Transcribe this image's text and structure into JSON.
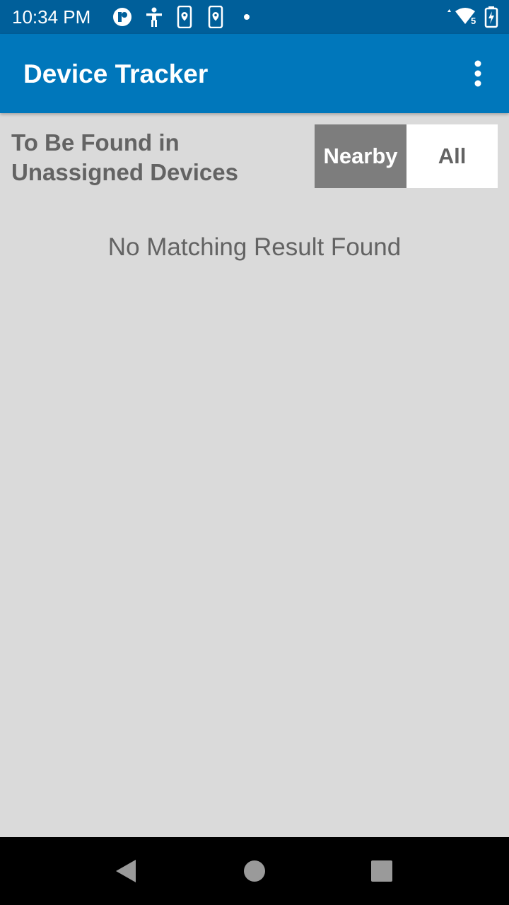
{
  "status_bar": {
    "time": "10:34 PM",
    "icons": [
      "app-notification-icon",
      "accessibility-icon",
      "device-location-icon",
      "device-location-icon",
      "dot-icon",
      "wifi-icon",
      "battery-charging-icon"
    ],
    "wifi_badge": "5"
  },
  "app_bar": {
    "title": "Device Tracker",
    "menu_icon": "more-vert-icon"
  },
  "header": {
    "title": "To Be Found in Unassigned Devices",
    "toggle": {
      "options": [
        "Nearby",
        "All"
      ],
      "selected": "Nearby"
    }
  },
  "results": {
    "empty_message": "No Matching Result Found"
  },
  "nav_bar": {
    "icons": [
      "back-icon",
      "home-icon",
      "recents-icon"
    ]
  },
  "colors": {
    "status_bar": "#005f9a",
    "app_bar": "#0077bb",
    "background": "#dadada",
    "selected_segment": "#7d7d7d",
    "text_gray": "#636363"
  }
}
